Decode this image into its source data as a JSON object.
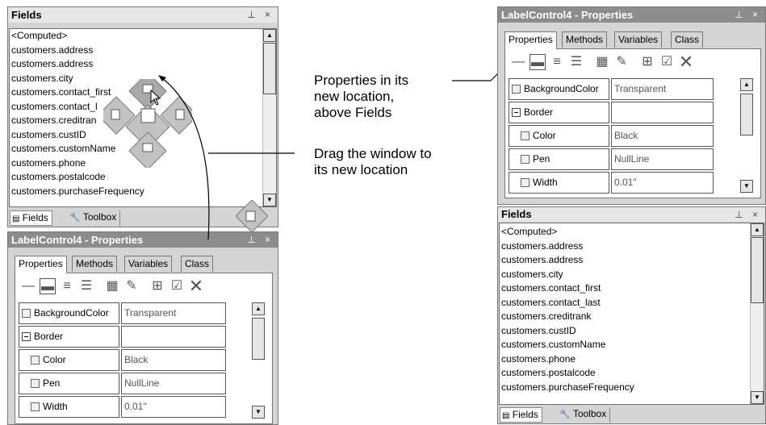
{
  "left": {
    "fields_title": "Fields",
    "fields_items": [
      "<Computed>",
      "customers.address",
      "customers.address",
      "customers.city",
      "customers.contact_first",
      "customers.contact_l",
      "customers.creditran",
      "customers.custID",
      "customers.customName",
      "customers.phone",
      "customers.postalcode",
      "customers.purchaseFrequency"
    ],
    "bottom_tabs": [
      "Fields",
      "Toolbox"
    ],
    "props_title": "LabelControl4 - Properties",
    "tabs": [
      "Properties",
      "Methods",
      "Variables",
      "Class"
    ],
    "grid": [
      {
        "name": "BackgroundColor",
        "value": "Transparent",
        "kind": "check"
      },
      {
        "name": "Border",
        "value": "",
        "kind": "minus"
      },
      {
        "name": "Color",
        "value": "Black",
        "kind": "child"
      },
      {
        "name": "Pen",
        "value": "NullLine",
        "kind": "child"
      },
      {
        "name": "Width",
        "value": "0.01\"",
        "kind": "child"
      }
    ]
  },
  "right": {
    "props_title": "LabelControl4 - Properties",
    "tabs": [
      "Properties",
      "Methods",
      "Variables",
      "Class"
    ],
    "grid": [
      {
        "name": "BackgroundColor",
        "value": "Transparent",
        "kind": "check"
      },
      {
        "name": "Border",
        "value": "",
        "kind": "minus"
      },
      {
        "name": "Color",
        "value": "Black",
        "kind": "child"
      },
      {
        "name": "Pen",
        "value": "NullLine",
        "kind": "child"
      },
      {
        "name": "Width",
        "value": "0.01\"",
        "kind": "child"
      }
    ],
    "fields_title": "Fields",
    "fields_items": [
      "<Computed>",
      "customers.address",
      "customers.address",
      "customers.city",
      "customers.contact_first",
      "customers.contact_last",
      "customers.creditrank",
      "customers.custID",
      "customers.customName",
      "customers.phone",
      "customers.postalcode",
      "customers.purchaseFrequency"
    ],
    "bottom_tabs": [
      "Fields",
      "Toolbox"
    ]
  },
  "callouts": {
    "properties_location": [
      "Properties in its",
      "new location,",
      "above Fields"
    ],
    "drag_window": [
      "Drag the window to",
      "its new location"
    ]
  },
  "title_icons": "⊥ ×",
  "icons": {
    "pin": "pin-icon",
    "close": "close-icon",
    "docking": "docking-guide-icon",
    "cursor": "arrow-cursor-icon"
  }
}
